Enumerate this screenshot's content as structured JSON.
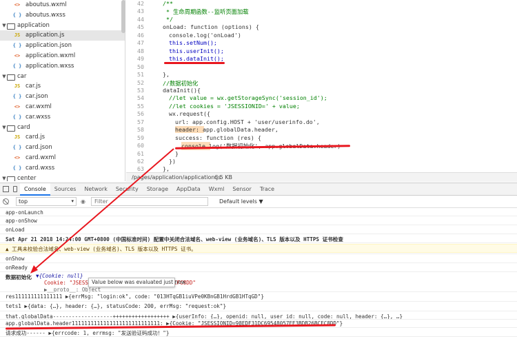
{
  "file_tree": {
    "items": [
      {
        "kind": "file",
        "icon": "<>",
        "color": "#e0632f",
        "label": "aboutus.wxml",
        "indent": 1
      },
      {
        "kind": "file",
        "icon": "{ }",
        "color": "#3b82c4",
        "label": "aboutus.wxss",
        "indent": 1
      },
      {
        "kind": "folder",
        "icon": "",
        "color": "#555",
        "label": "application",
        "indent": 0
      },
      {
        "kind": "file",
        "icon": "JS",
        "color": "#c9a500",
        "label": "application.js",
        "indent": 1,
        "selected": true
      },
      {
        "kind": "file",
        "icon": "{ }",
        "color": "#3b82c4",
        "label": "application.json",
        "indent": 1
      },
      {
        "kind": "file",
        "icon": "<>",
        "color": "#e0632f",
        "label": "application.wxml",
        "indent": 1
      },
      {
        "kind": "file",
        "icon": "{ }",
        "color": "#3b82c4",
        "label": "application.wxss",
        "indent": 1
      },
      {
        "kind": "folder",
        "icon": "",
        "color": "#555",
        "label": "car",
        "indent": 0
      },
      {
        "kind": "file",
        "icon": "JS",
        "color": "#c9a500",
        "label": "car.js",
        "indent": 1
      },
      {
        "kind": "file",
        "icon": "{ }",
        "color": "#3b82c4",
        "label": "car.json",
        "indent": 1
      },
      {
        "kind": "file",
        "icon": "<>",
        "color": "#e0632f",
        "label": "car.wxml",
        "indent": 1
      },
      {
        "kind": "file",
        "icon": "{ }",
        "color": "#3b82c4",
        "label": "car.wxss",
        "indent": 1
      },
      {
        "kind": "folder",
        "icon": "",
        "color": "#555",
        "label": "card",
        "indent": 0
      },
      {
        "kind": "file",
        "icon": "JS",
        "color": "#c9a500",
        "label": "card.js",
        "indent": 1
      },
      {
        "kind": "file",
        "icon": "{ }",
        "color": "#3b82c4",
        "label": "card.json",
        "indent": 1
      },
      {
        "kind": "file",
        "icon": "<>",
        "color": "#e0632f",
        "label": "card.wxml",
        "indent": 1
      },
      {
        "kind": "file",
        "icon": "{ }",
        "color": "#3b82c4",
        "label": "card.wxss",
        "indent": 1
      },
      {
        "kind": "folder",
        "icon": "",
        "color": "#555",
        "label": "center",
        "indent": 0
      }
    ]
  },
  "editor": {
    "lines": [
      {
        "n": "42",
        "t": "/**",
        "c": "cm",
        "ind": 0
      },
      {
        "n": "43",
        "t": " * 生命周期函数--监听页面加载",
        "c": "cm",
        "ind": 0
      },
      {
        "n": "44",
        "t": " */",
        "c": "cm",
        "ind": 0
      },
      {
        "n": "45",
        "t": "onLoad: function (options) {",
        "c": "",
        "ind": 0
      },
      {
        "n": "46",
        "t": "console.log('onLoad')",
        "c": "",
        "ind": 1
      },
      {
        "n": "47",
        "t": "this.setNum();",
        "c": "kw",
        "ind": 1
      },
      {
        "n": "48",
        "t": "this.userInit();",
        "c": "kw",
        "ind": 1
      },
      {
        "n": "49",
        "t": "this.dataInit();",
        "c": "kw",
        "ind": 1
      },
      {
        "n": "50",
        "t": "",
        "c": "",
        "ind": 0
      },
      {
        "n": "51",
        "t": "},",
        "c": "",
        "ind": 0
      },
      {
        "n": "52",
        "t": "//数据初始化",
        "c": "cm",
        "ind": 0
      },
      {
        "n": "53",
        "t": "dataInit(){",
        "c": "",
        "ind": 0
      },
      {
        "n": "54",
        "t": "//let value = wx.getStorageSync('session_id');",
        "c": "cm",
        "ind": 1
      },
      {
        "n": "55",
        "t": "//let cookies = 'JSESSIONID=' + value;",
        "c": "cm",
        "ind": 1
      },
      {
        "n": "56",
        "t": "wx.request({",
        "c": "",
        "ind": 1
      },
      {
        "n": "57",
        "t": "url: app.config.HOST + 'user/userinfo.do',",
        "c": "",
        "ind": 2
      },
      {
        "n": "58",
        "t": "header: app.globalData.header,",
        "c": "hlh",
        "ind": 2
      },
      {
        "n": "59",
        "t": "success: function (res) {",
        "c": "",
        "ind": 2
      },
      {
        "n": "60",
        "t": "console.log('数据初始化', app.globalData.header)",
        "c": "hlh2",
        "ind": 3
      },
      {
        "n": "61",
        "t": "}",
        "c": "",
        "ind": 2
      },
      {
        "n": "62",
        "t": "})",
        "c": "",
        "ind": 1
      },
      {
        "n": "63",
        "t": "},",
        "c": "",
        "ind": 0
      }
    ]
  },
  "statusbar": {
    "path": "/pages/application/application.js",
    "size": "6.5 KB"
  },
  "devtools": {
    "tabs": [
      "Console",
      "Sources",
      "Network",
      "Security",
      "Storage",
      "AppData",
      "Wxml",
      "Sensor",
      "Trace"
    ],
    "active": "Console"
  },
  "filter": {
    "context": "top",
    "placeholder": "Filter",
    "levels": "Default levels ▼"
  },
  "console": {
    "lines": [
      "app-onLaunch",
      "app-onShow",
      "onLoad",
      "Sat Apr 21 2018 14:24:00 GMT+0800 (中国标准时间) 配置中关闭合法域名、web-view (业务域名)、TLS 版本以及 HTTPS 证书检查",
      "▲ 工具未校验合法域名、web-view (业务域名)、TLS 版本以及 HTTPS 证书。",
      "onShow",
      "onReady",
      "数据初始化",
      "▼{Cookie: null}",
      "Cookie: \"JSESSI",
      "CFC8DD\"",
      "▶__proto__: Object",
      "res111111111111111 ▶{errMsg: \"login:ok\", code: \"013HTqGB1iuVPe0KBnGB1HrdGB1HTqGD\"}",
      "tets1 ▶{data: {…}, header: {…}, statusCode: 200, errMsg: \"request:ok\"}",
      "that.globalData-------------------++++++++++++++++++ ▶{userInfo: {…}, openid: null, user_id: null, code: null, header: {…}, …}",
      "app.globalData.header1111111111111111111111111111: ▶{Cookie: \"JSESSIONID=98EDF31DC69548057EE3BDB26BCFC8DD\"}",
      "请求成功------ ▶{errcode: 1, errmsg: \"发送验证码成功！\"}"
    ],
    "tooltip": "Value below was evaluated just now."
  }
}
